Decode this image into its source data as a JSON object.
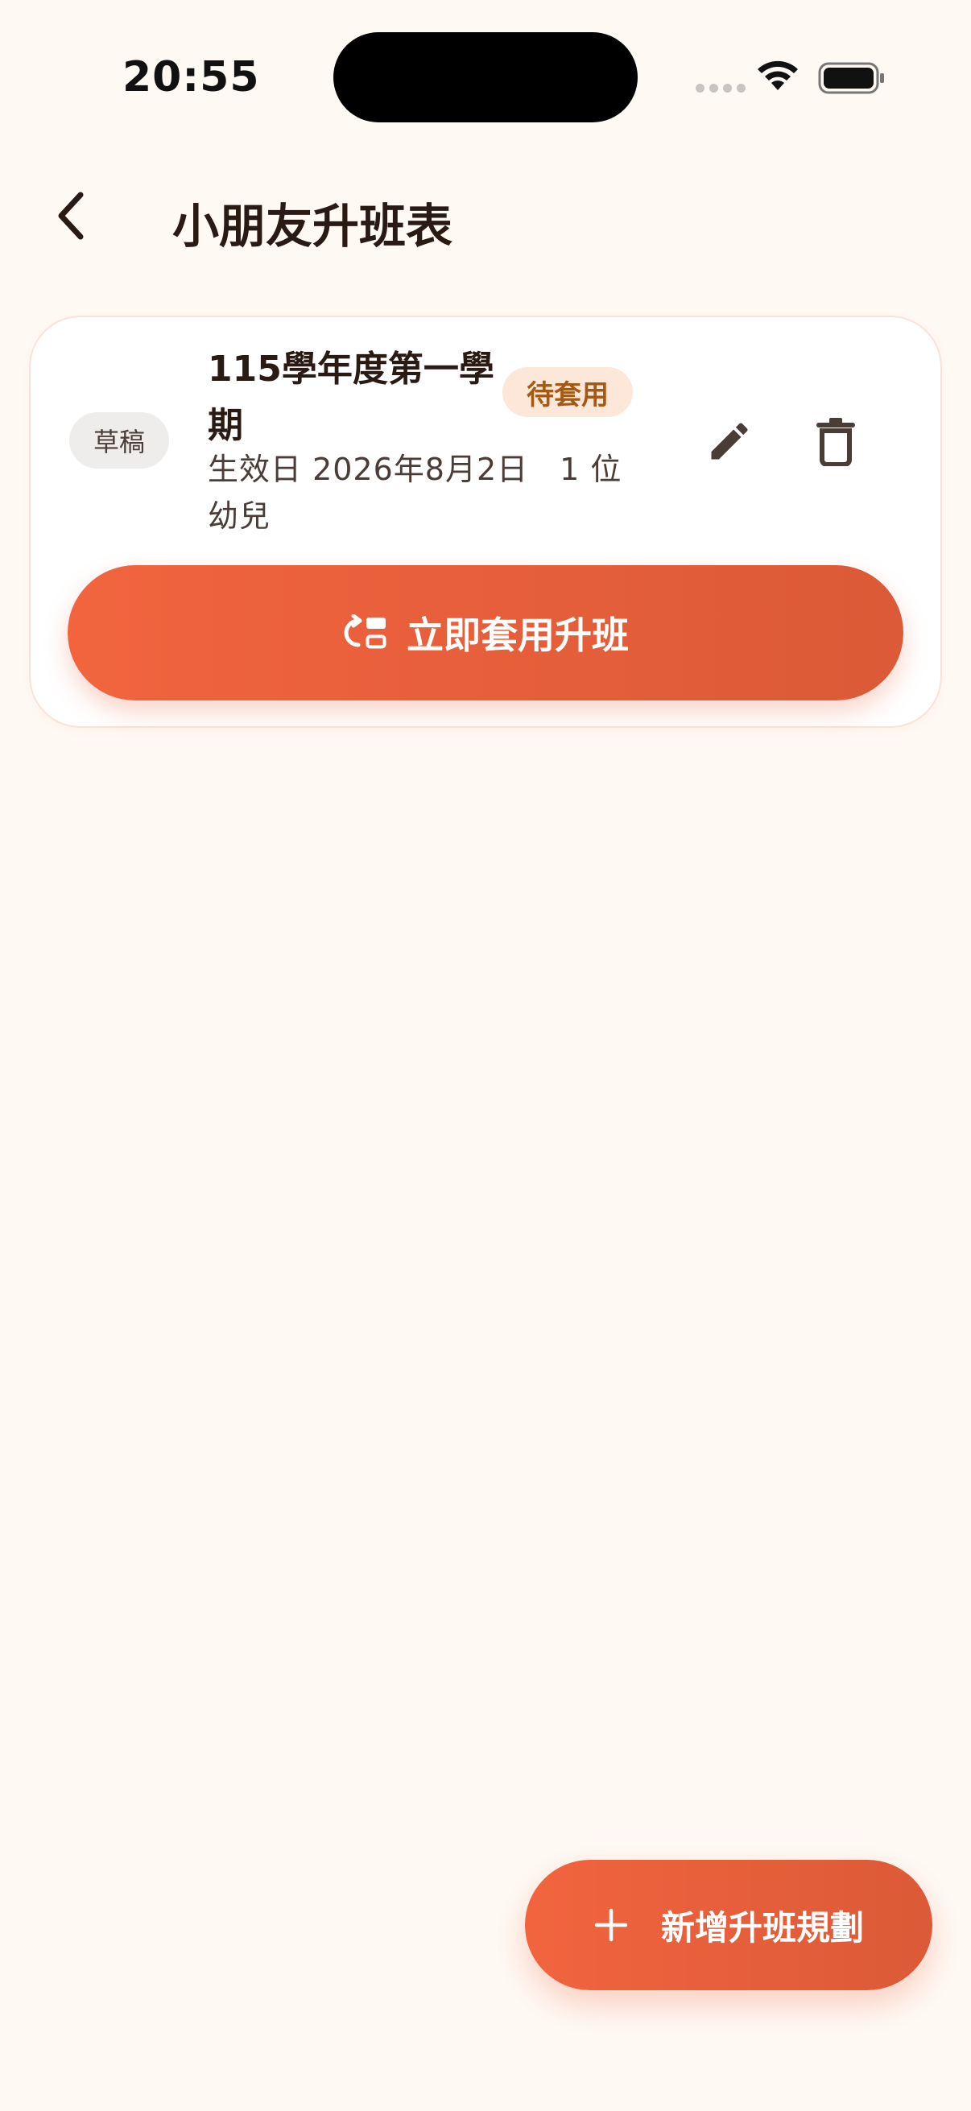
{
  "status_bar": {
    "time": "20:55"
  },
  "header": {
    "title": "小朋友升班表",
    "back_icon": "chevron-left-icon"
  },
  "plan_card": {
    "status_badge": "草稿",
    "title": "115學年度第一學期",
    "pending_badge": "待套用",
    "meta": "生效日 2026年8月2日　1 位幼兒",
    "edit_icon": "pencil-icon",
    "delete_icon": "trash-icon",
    "apply_label": "立即套用升班",
    "apply_icon": "apply-swap-icon"
  },
  "fab": {
    "label": "新增升班規劃",
    "icon": "plus-icon"
  },
  "colors": {
    "background": "#FFF9F4",
    "accent": "#EE623C",
    "text_primary": "#2A1A14",
    "text_secondary": "#4A3C36",
    "pending_badge_bg": "#FDE7D8",
    "pending_badge_text": "#A25A14",
    "draft_badge_bg": "#EFEDEC"
  }
}
